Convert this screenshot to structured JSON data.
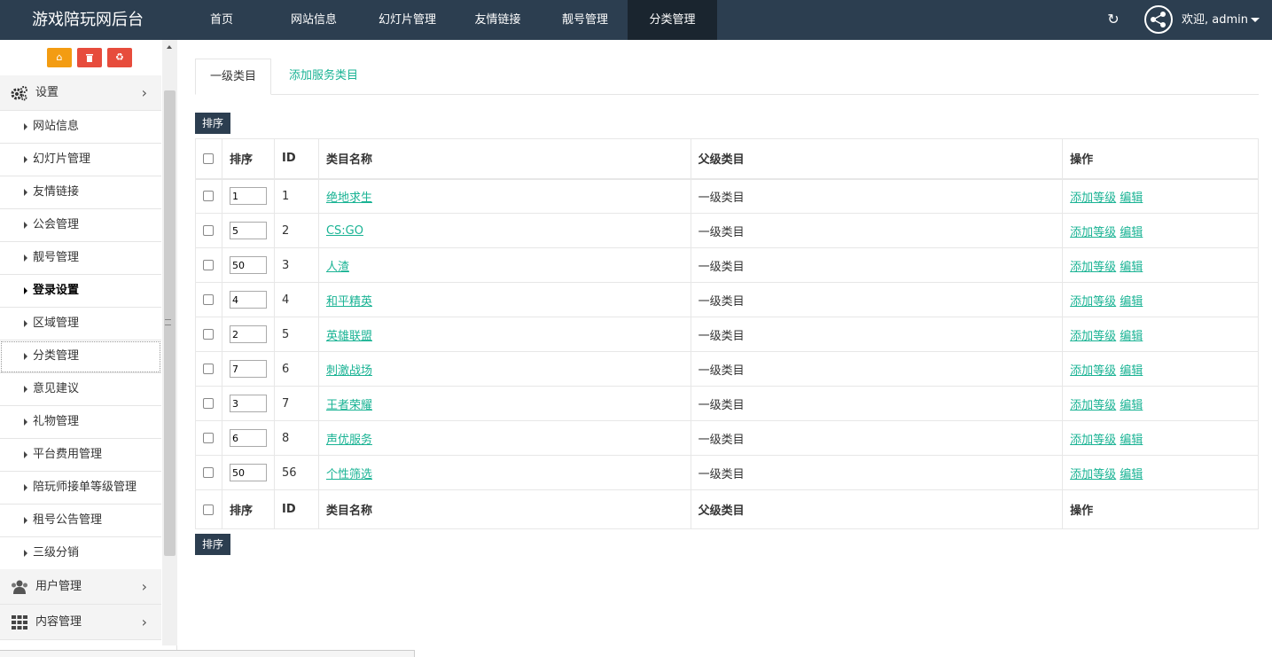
{
  "app": {
    "title": "游戏陪玩网后台"
  },
  "topnav": [
    {
      "label": "首页",
      "active": false
    },
    {
      "label": "网站信息",
      "active": false
    },
    {
      "label": "幻灯片管理",
      "active": false
    },
    {
      "label": "友情链接",
      "active": false
    },
    {
      "label": "靓号管理",
      "active": false
    },
    {
      "label": "分类管理",
      "active": true
    }
  ],
  "user": {
    "welcome": "欢迎, admin"
  },
  "sidebar": {
    "tools": [
      {
        "icon": "home-icon",
        "color": "#f39c12"
      },
      {
        "icon": "trash-icon",
        "color": "#e74c3c"
      },
      {
        "icon": "recycle-icon",
        "color": "#e74c3c"
      }
    ],
    "groups": [
      {
        "label": "设置",
        "icon": "gears-icon"
      },
      {
        "label": "用户管理",
        "icon": "users-icon"
      },
      {
        "label": "内容管理",
        "icon": "grid-icon"
      }
    ],
    "items": [
      {
        "label": "网站信息"
      },
      {
        "label": "幻灯片管理"
      },
      {
        "label": "友情链接"
      },
      {
        "label": "公会管理"
      },
      {
        "label": "靓号管理"
      },
      {
        "label": "登录设置",
        "bold": true
      },
      {
        "label": "区域管理"
      },
      {
        "label": "分类管理",
        "focus": true
      },
      {
        "label": "意见建议"
      },
      {
        "label": "礼物管理"
      },
      {
        "label": "平台费用管理"
      },
      {
        "label": "陪玩师接单等级管理"
      },
      {
        "label": "租号公告管理"
      },
      {
        "label": "三级分销"
      }
    ]
  },
  "tabs": {
    "active": "一级类目",
    "add": "添加服务类目"
  },
  "sort_button": "排序",
  "table": {
    "headers": {
      "sort": "排序",
      "id": "ID",
      "name": "类目名称",
      "parent": "父级类目",
      "ops": "操作"
    },
    "add_level": "添加等级",
    "edit": "编辑",
    "rows": [
      {
        "sort": "1",
        "id": "1",
        "name": "绝地求生",
        "parent": "一级类目"
      },
      {
        "sort": "5",
        "id": "2",
        "name": "CS:GO",
        "parent": "一级类目"
      },
      {
        "sort": "50",
        "id": "3",
        "name": "人渣",
        "parent": "一级类目"
      },
      {
        "sort": "4",
        "id": "4",
        "name": "和平精英",
        "parent": "一级类目"
      },
      {
        "sort": "2",
        "id": "5",
        "name": "英雄联盟",
        "parent": "一级类目"
      },
      {
        "sort": "7",
        "id": "6",
        "name": "刺激战场",
        "parent": "一级类目"
      },
      {
        "sort": "3",
        "id": "7",
        "name": "王者荣耀",
        "parent": "一级类目"
      },
      {
        "sort": "6",
        "id": "8",
        "name": "声优服务",
        "parent": "一级类目"
      },
      {
        "sort": "50",
        "id": "56",
        "name": "个性筛选",
        "parent": "一级类目"
      }
    ]
  },
  "colors": {
    "navbar": "#2c3e50",
    "accent": "#1ab394"
  }
}
